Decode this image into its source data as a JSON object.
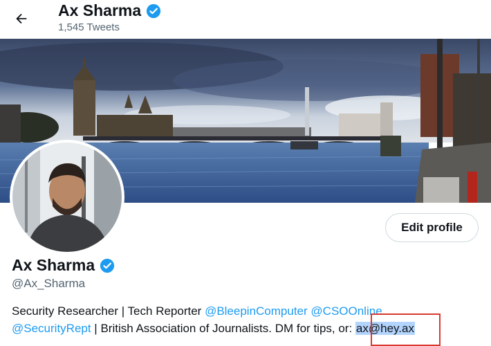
{
  "header": {
    "name": "Ax Sharma",
    "tweet_count": "1,545 Tweets"
  },
  "profile": {
    "name": "Ax Sharma",
    "handle": "@Ax_Sharma",
    "edit_button": "Edit profile",
    "bio": {
      "line1_text": "Security Researcher | Tech Reporter ",
      "mention1": "@BleepinComputer",
      "mention2": "@CSOOnline",
      "mention3": "@SecurityRept",
      "line2_text": " | British Association of Journalists. DM for tips, or: ",
      "email": "ax@hey.ax"
    }
  },
  "icons": {
    "back": "arrow-left-icon",
    "verified": "verified-badge-icon"
  },
  "colors": {
    "accent": "#1d9bf0",
    "verified": "#1d9bf0",
    "annotation": "#d9382f"
  }
}
